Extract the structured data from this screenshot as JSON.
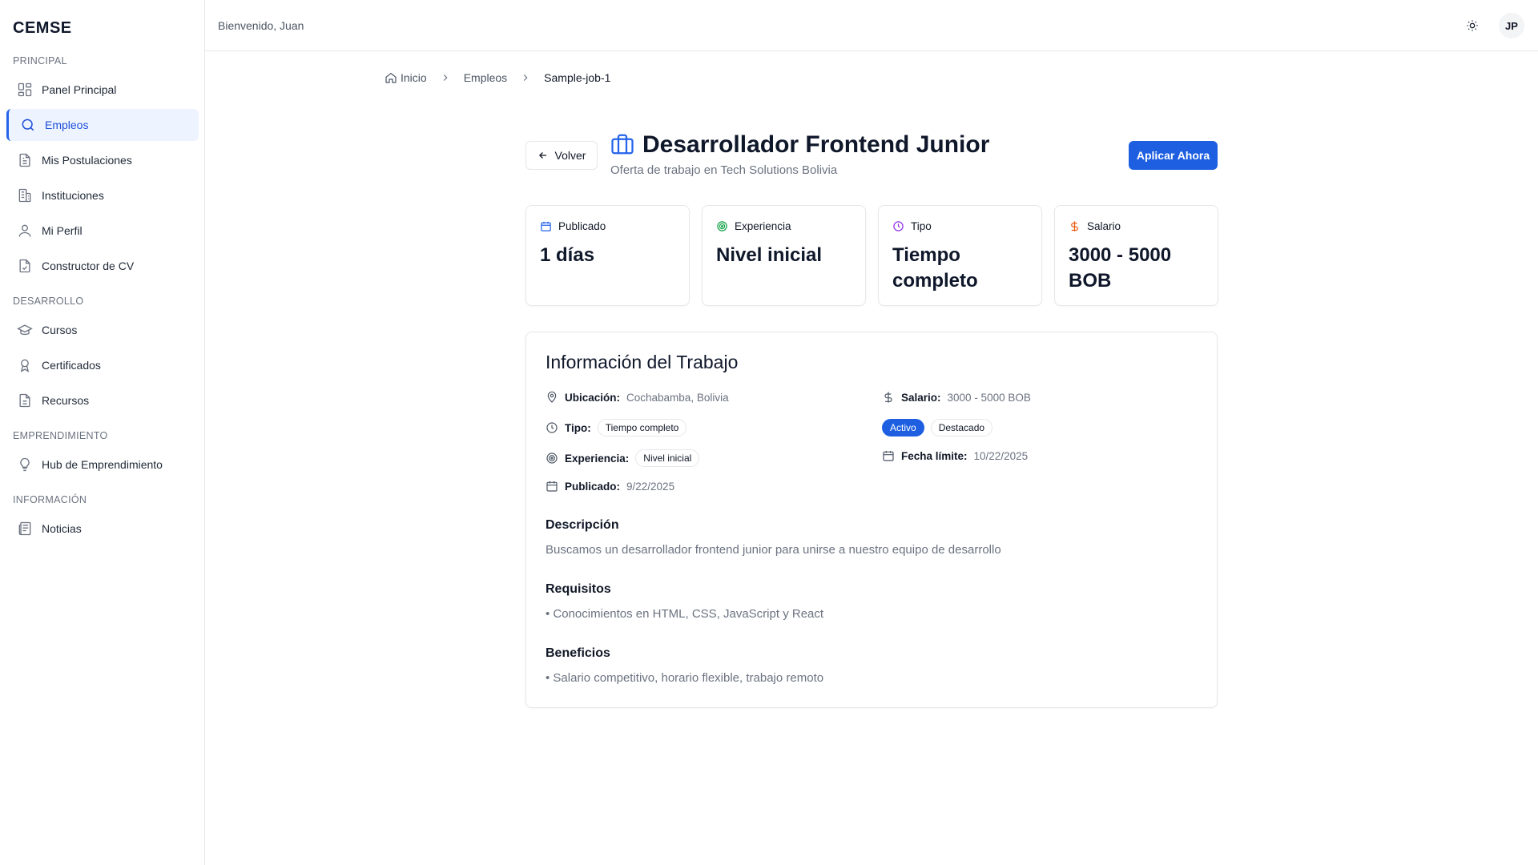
{
  "app": {
    "brand": "CEMSE"
  },
  "sidebar": {
    "sections": [
      {
        "title": "PRINCIPAL"
      },
      {
        "title": "DESARROLLO"
      },
      {
        "title": "EMPRENDIMIENTO"
      },
      {
        "title": "INFORMACIÓN"
      }
    ],
    "items": [
      {
        "label": "Panel Principal",
        "icon": "layout-grid-icon"
      },
      {
        "label": "Empleos",
        "icon": "search-icon",
        "active": true
      },
      {
        "label": "Mis Postulaciones",
        "icon": "file-text-icon"
      },
      {
        "label": "Instituciones",
        "icon": "building-icon"
      },
      {
        "label": "Mi Perfil",
        "icon": "user-icon"
      },
      {
        "label": "Constructor de CV",
        "icon": "file-check-icon"
      },
      {
        "label": "Cursos",
        "icon": "graduation-cap-icon"
      },
      {
        "label": "Certificados",
        "icon": "award-icon"
      },
      {
        "label": "Recursos",
        "icon": "file-icon"
      },
      {
        "label": "Hub de Emprendimiento",
        "icon": "lightbulb-icon"
      },
      {
        "label": "Noticias",
        "icon": "newspaper-icon"
      }
    ]
  },
  "topbar": {
    "welcome": "Bienvenido, Juan",
    "avatar_initials": "JP"
  },
  "breadcrumb": {
    "home": "Inicio",
    "section": "Empleos",
    "current": "Sample-job-1"
  },
  "header": {
    "back_label": "Volver",
    "title": "Desarrollador Frontend Junior",
    "subtitle": "Oferta de trabajo en Tech Solutions Bolivia",
    "apply_label": "Aplicar Ahora"
  },
  "stats": [
    {
      "label": "Publicado",
      "value": "1 días",
      "color": "#2563eb"
    },
    {
      "label": "Experiencia",
      "value": "Nivel inicial",
      "color": "#16a34a"
    },
    {
      "label": "Tipo",
      "value": "Tiempo completo",
      "color": "#9333ea"
    },
    {
      "label": "Salario",
      "value": "3000 - 5000 BOB",
      "color": "#ea580c"
    }
  ],
  "info": {
    "title": "Información del Trabajo",
    "location_label": "Ubicación:",
    "location_value": "Cochabamba, Bolivia",
    "type_label": "Tipo:",
    "type_value": "Tiempo completo",
    "experience_label": "Experiencia:",
    "experience_value": "Nivel inicial",
    "published_label": "Publicado:",
    "published_value": "9/22/2025",
    "salary_label": "Salario:",
    "salary_value": "3000 - 5000 BOB",
    "status_badge": "Activo",
    "featured_badge": "Destacado",
    "deadline_label": "Fecha límite:",
    "deadline_value": "10/22/2025",
    "description_title": "Descripción",
    "description_text": "Buscamos un desarrollador frontend junior para unirse a nuestro equipo de desarrollo",
    "requirements_title": "Requisitos",
    "requirements_text": "• Conocimientos en HTML, CSS, JavaScript y React",
    "benefits_title": "Beneficios",
    "benefits_text": "• Salario competitivo, horario flexible, trabajo remoto"
  }
}
